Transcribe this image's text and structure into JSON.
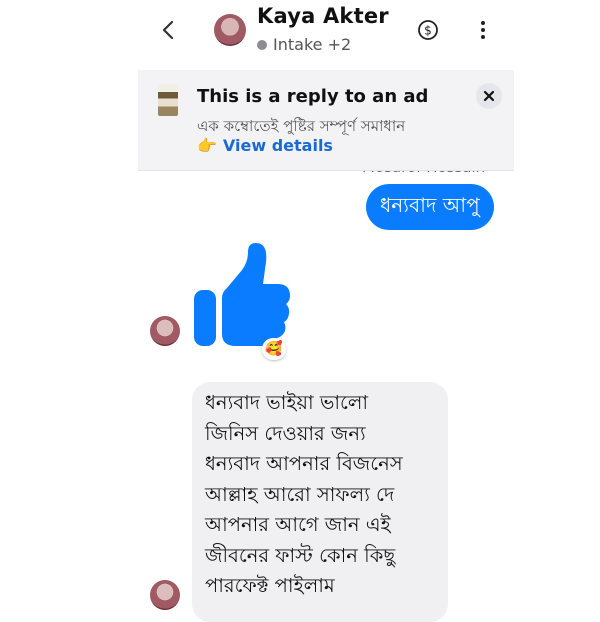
{
  "header": {
    "contact_name": "Kaya Akter",
    "subtitle": "Intake +2",
    "icons": [
      "back-chevron-icon",
      "dollar-circle-icon",
      "more-vertical-icon"
    ]
  },
  "ad_card": {
    "title": "This is a reply to an ad",
    "subtitle": "এক কম্বোতেই পুষ্টির সম্পূর্ণ সমাধান",
    "link_emoji": "👉",
    "link_text": "View details"
  },
  "sender_name_partial": "Mosarof Hossain",
  "messages": {
    "outgoing_1": "ধন্যবাদ আপু",
    "reaction_emoji": "🥰",
    "incoming_lines": [
      "ধন্যবাদ ভাইয়া ভালো",
      "জিনিস দেওয়ার জন্য",
      "ধন্যবাদ আপনার বিজনেস",
      "আল্লাহ আরো সাফল্য দে",
      "আপনার আগে জান এই",
      "জীবনের ফাস্ট কোন কিছু",
      "পারফেক্ট পাইলাম"
    ]
  },
  "colors": {
    "accent": "#0a7cff",
    "link": "#1a6ad1",
    "incoming_bubble": "#f0f0f2"
  }
}
